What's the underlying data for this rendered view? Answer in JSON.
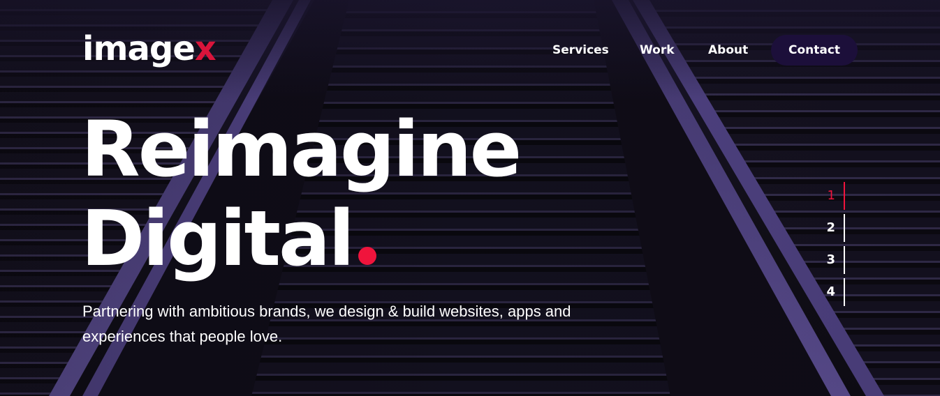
{
  "brand": {
    "logo_main": "image",
    "logo_x": "x",
    "accent_color": "#f0143c",
    "nav_button_color": "#1c0f3a"
  },
  "nav": {
    "items": [
      {
        "label": "Services"
      },
      {
        "label": "Work"
      },
      {
        "label": "About"
      }
    ],
    "contact_label": "Contact"
  },
  "hero": {
    "headline_line1": "Reimagine",
    "headline_line2": "Digital",
    "subtitle": "Partnering with ambitious brands, we design & build websites, apps and experiences that people love."
  },
  "slider": {
    "active": 1,
    "items": [
      "1",
      "2",
      "3",
      "4"
    ]
  }
}
